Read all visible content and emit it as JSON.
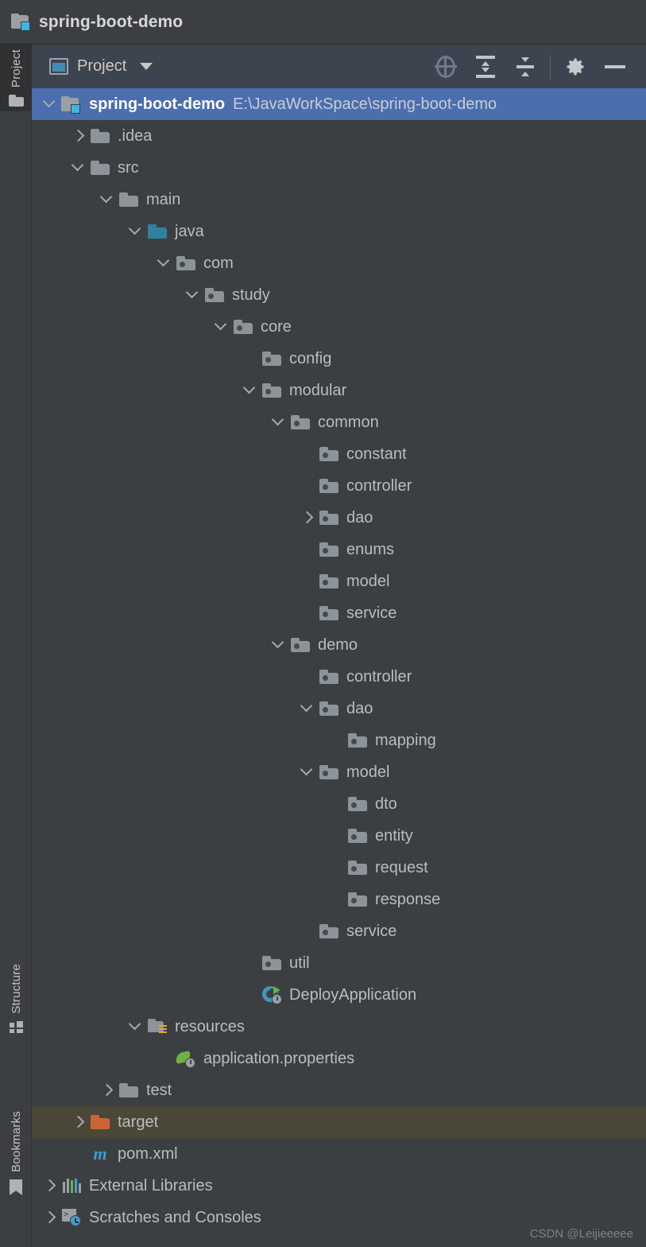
{
  "window": {
    "title": "spring-boot-demo",
    "title_icon": "module-folder-icon"
  },
  "toolbar": {
    "view_label": "Project",
    "view_icon": "project-view-icon",
    "dropdown_icon": "chevron-down-icon",
    "buttons": [
      {
        "name": "select-opened-file",
        "icon": "crosshair-icon"
      },
      {
        "name": "expand-all",
        "icon": "expand-all-icon"
      },
      {
        "name": "collapse-all",
        "icon": "collapse-all-icon"
      },
      {
        "name": "settings",
        "icon": "gear-icon"
      },
      {
        "name": "hide",
        "icon": "minus-icon"
      }
    ]
  },
  "toolstrip": {
    "items": [
      {
        "label": "Project",
        "icon": "folder-icon",
        "active": true
      },
      {
        "label": "Structure",
        "icon": "structure-icon",
        "active": false
      },
      {
        "label": "Bookmarks",
        "icon": "bookmark-icon",
        "active": false
      }
    ]
  },
  "tree": {
    "rows": [
      {
        "label": "spring-boot-demo",
        "sub": "E:\\JavaWorkSpace\\spring-boot-demo",
        "depth": 0,
        "twisty": "open",
        "icon": "module",
        "state": "selected"
      },
      {
        "label": ".idea",
        "sub": "",
        "depth": 1,
        "twisty": "closed",
        "icon": "folder",
        "state": ""
      },
      {
        "label": "src",
        "sub": "",
        "depth": 1,
        "twisty": "open",
        "icon": "folder",
        "state": ""
      },
      {
        "label": "main",
        "sub": "",
        "depth": 2,
        "twisty": "open",
        "icon": "folder",
        "state": ""
      },
      {
        "label": "java",
        "sub": "",
        "depth": 3,
        "twisty": "open",
        "icon": "source",
        "state": ""
      },
      {
        "label": "com",
        "sub": "",
        "depth": 4,
        "twisty": "open",
        "icon": "package",
        "state": ""
      },
      {
        "label": "study",
        "sub": "",
        "depth": 5,
        "twisty": "open",
        "icon": "package",
        "state": ""
      },
      {
        "label": "core",
        "sub": "",
        "depth": 6,
        "twisty": "open",
        "icon": "package",
        "state": ""
      },
      {
        "label": "config",
        "sub": "",
        "depth": 7,
        "twisty": "none",
        "icon": "package",
        "state": ""
      },
      {
        "label": "modular",
        "sub": "",
        "depth": 7,
        "twisty": "open",
        "icon": "package",
        "state": ""
      },
      {
        "label": "common",
        "sub": "",
        "depth": 8,
        "twisty": "open",
        "icon": "package",
        "state": ""
      },
      {
        "label": "constant",
        "sub": "",
        "depth": 9,
        "twisty": "none",
        "icon": "package",
        "state": ""
      },
      {
        "label": "controller",
        "sub": "",
        "depth": 9,
        "twisty": "none",
        "icon": "package",
        "state": ""
      },
      {
        "label": "dao",
        "sub": "",
        "depth": 9,
        "twisty": "closed",
        "icon": "package",
        "state": ""
      },
      {
        "label": "enums",
        "sub": "",
        "depth": 9,
        "twisty": "none",
        "icon": "package",
        "state": ""
      },
      {
        "label": "model",
        "sub": "",
        "depth": 9,
        "twisty": "none",
        "icon": "package",
        "state": ""
      },
      {
        "label": "service",
        "sub": "",
        "depth": 9,
        "twisty": "none",
        "icon": "package",
        "state": ""
      },
      {
        "label": "demo",
        "sub": "",
        "depth": 8,
        "twisty": "open",
        "icon": "package",
        "state": ""
      },
      {
        "label": "controller",
        "sub": "",
        "depth": 9,
        "twisty": "none",
        "icon": "package",
        "state": ""
      },
      {
        "label": "dao",
        "sub": "",
        "depth": 9,
        "twisty": "open",
        "icon": "package",
        "state": ""
      },
      {
        "label": "mapping",
        "sub": "",
        "depth": 10,
        "twisty": "none",
        "icon": "package",
        "state": ""
      },
      {
        "label": "model",
        "sub": "",
        "depth": 9,
        "twisty": "open",
        "icon": "package",
        "state": ""
      },
      {
        "label": "dto",
        "sub": "",
        "depth": 10,
        "twisty": "none",
        "icon": "package",
        "state": ""
      },
      {
        "label": "entity",
        "sub": "",
        "depth": 10,
        "twisty": "none",
        "icon": "package",
        "state": ""
      },
      {
        "label": "request",
        "sub": "",
        "depth": 10,
        "twisty": "none",
        "icon": "package",
        "state": ""
      },
      {
        "label": "response",
        "sub": "",
        "depth": 10,
        "twisty": "none",
        "icon": "package",
        "state": ""
      },
      {
        "label": "service",
        "sub": "",
        "depth": 9,
        "twisty": "none",
        "icon": "package",
        "state": ""
      },
      {
        "label": "util",
        "sub": "",
        "depth": 7,
        "twisty": "none",
        "icon": "package",
        "state": ""
      },
      {
        "label": "DeployApplication",
        "sub": "",
        "depth": 7,
        "twisty": "none",
        "icon": "java-class-run",
        "state": ""
      },
      {
        "label": "resources",
        "sub": "",
        "depth": 3,
        "twisty": "open",
        "icon": "resources",
        "state": ""
      },
      {
        "label": "application.properties",
        "sub": "",
        "depth": 4,
        "twisty": "none",
        "icon": "spring-properties",
        "state": ""
      },
      {
        "label": "test",
        "sub": "",
        "depth": 2,
        "twisty": "closed",
        "icon": "folder",
        "state": ""
      },
      {
        "label": "target",
        "sub": "",
        "depth": 1,
        "twisty": "closed",
        "icon": "folder-excluded",
        "state": "hovered"
      },
      {
        "label": "pom.xml",
        "sub": "",
        "depth": 1,
        "twisty": "none",
        "icon": "maven",
        "state": ""
      },
      {
        "label": "External Libraries",
        "sub": "",
        "depth": 0,
        "twisty": "closed",
        "icon": "libraries",
        "state": ""
      },
      {
        "label": "Scratches and Consoles",
        "sub": "",
        "depth": 0,
        "twisty": "closed",
        "icon": "scratches",
        "state": ""
      }
    ]
  },
  "watermark": {
    "text": "CSDN @Leijieeeee"
  },
  "colors": {
    "tree_bg": "#3c3f41",
    "toolbar_bg": "#3c4450",
    "selection": "#4b6eaf",
    "hover": "#4c4838",
    "text": "#b9bdc0",
    "source_root": "#3180a0",
    "excluded": "#cd6436"
  }
}
